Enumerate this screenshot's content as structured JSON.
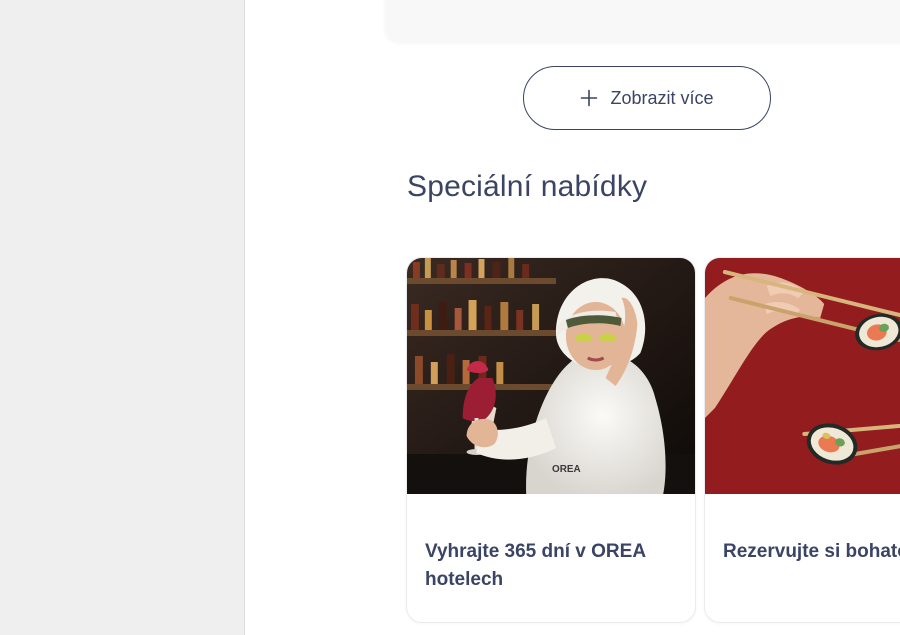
{
  "show_more": {
    "label": "Zobrazit více",
    "icon": "plus-icon"
  },
  "section": {
    "title": "Speciální nabídky"
  },
  "offers": [
    {
      "title": "Vyhrajte 365 dní v OREA hotelech",
      "image": "spa-woman-with-wine-photo",
      "bathrobe_logo": "OREA"
    },
    {
      "title": "Rezervujte si bohatou bufetovou večeři",
      "image": "sushi-chopsticks-photo"
    }
  ],
  "colors": {
    "text": "#3b4464",
    "border": "#3b4464",
    "gutter": "#efefef",
    "card_bg": "#ffffff",
    "sushi_bg": "#9a1f20"
  }
}
